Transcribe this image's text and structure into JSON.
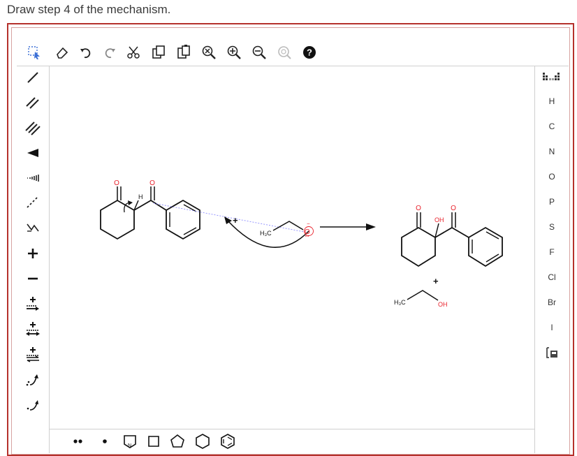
{
  "prompt": "Draw step 4 of the mechanism.",
  "right_toolbar": {
    "elements": [
      "H",
      "C",
      "N",
      "O",
      "P",
      "S",
      "F",
      "Cl",
      "Br",
      "I"
    ]
  },
  "canvas": {
    "labels": {
      "o1": "O",
      "o2": "O",
      "h": "H",
      "plus1": "+",
      "h3c1": "H₃C",
      "o_anion": "O",
      "neg": "−",
      "o3": "O",
      "oh": "OH",
      "o4": "O",
      "plus2": "+",
      "h3c2": "H₃C",
      "oh2": "OH"
    }
  },
  "colors": {
    "accent_red": "#b5312c",
    "oxygen": "#e8212b",
    "toolbar_border": "#cfcfcf"
  },
  "icons": {
    "top": [
      "select-lasso-icon",
      "eraser-icon",
      "undo-icon",
      "redo-icon",
      "cut-icon",
      "copy-icon",
      "paste-icon",
      "zoom-clear-icon",
      "zoom-in-icon",
      "zoom-out-icon",
      "clean-icon",
      "help-icon"
    ]
  }
}
